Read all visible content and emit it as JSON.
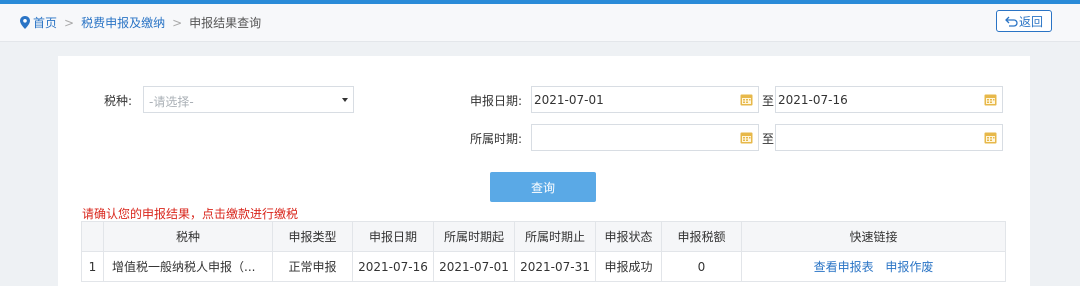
{
  "breadcrumb": {
    "home": "首页",
    "level1": "税费申报及缴纳",
    "current": "申报结果查询"
  },
  "back_button": "返回",
  "form": {
    "tax_type_label": "税种:",
    "tax_type_placeholder": "-请选择-",
    "declare_date_label": "申报日期:",
    "declare_date_from": "2021-07-01",
    "declare_date_to": "2021-07-16",
    "period_label": "所属时期:",
    "period_from": "",
    "period_to": "",
    "to_label": "至",
    "query_button": "查询"
  },
  "notice": "请确认您的申报结果，点击缴款进行缴税",
  "table": {
    "columns": [
      "",
      "税种",
      "申报类型",
      "申报日期",
      "所属时期起",
      "所属时期止",
      "申报状态",
      "申报税额",
      "快速链接"
    ],
    "rows": [
      {
        "index": "1",
        "tax": "增值税一般纳税人申报（...",
        "type": "正常申报",
        "date": "2021-07-16",
        "period_start": "2021-07-01",
        "period_end": "2021-07-31",
        "status": "申报成功",
        "amount": "0",
        "link_view": "查看申报表",
        "link_void": "申报作废"
      }
    ]
  },
  "colors": {
    "accent": "#2a74c5",
    "button": "#5aa9e6",
    "notice": "#d9261c",
    "calendar_icon": "#e7b84a"
  }
}
